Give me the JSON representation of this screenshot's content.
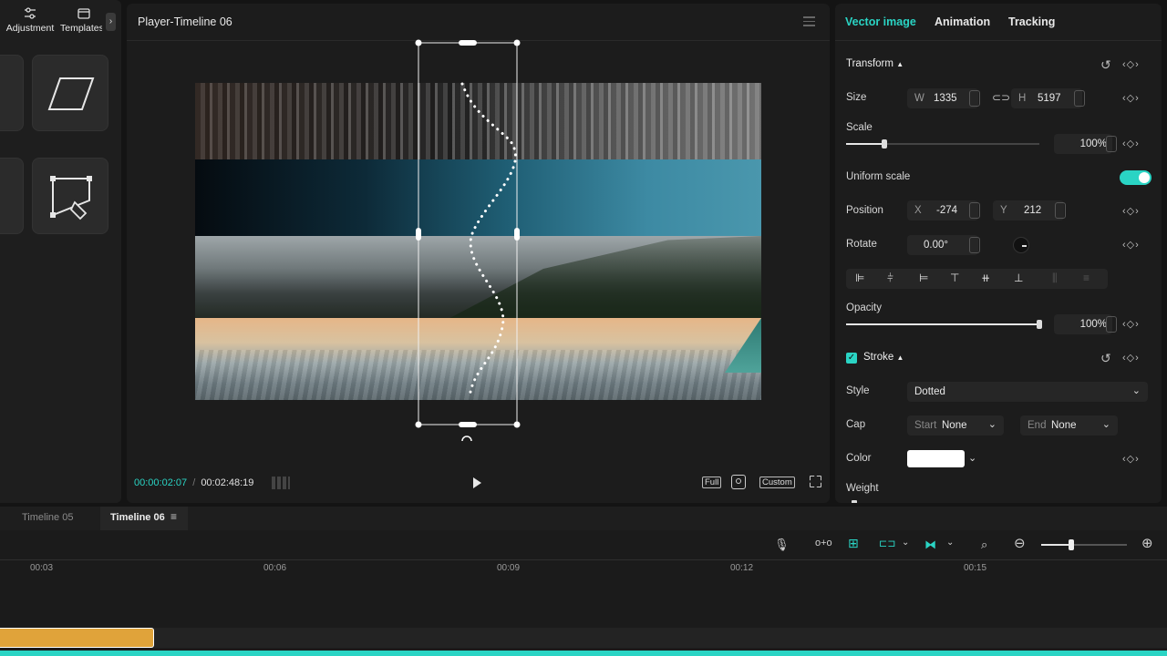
{
  "left_panel": {
    "tabs": [
      {
        "label": "Adjustment",
        "icon": "sliders-icon"
      },
      {
        "label": "Templates",
        "icon": "template-icon"
      }
    ],
    "tiles": [
      {
        "icon": "parallelogram-shape-icon"
      },
      {
        "icon": "pen-path-icon"
      }
    ]
  },
  "player": {
    "title": "Player-Timeline 06",
    "current_time": "00:00:02:07",
    "separator": "/",
    "total_time": "00:02:48:19",
    "full_label": "Full",
    "custom_label": "Custom"
  },
  "inspector": {
    "tabs": [
      "Vector image",
      "Animation",
      "Tracking"
    ],
    "active_tab_color": "#2ad4c4",
    "transform_label": "Transform",
    "size_label": "Size",
    "size_w_label": "W",
    "size_w": "1335",
    "size_h_label": "H",
    "size_h": "5197",
    "scale_label": "Scale",
    "scale_value": "100%",
    "scale_fraction": 0.2,
    "uniform_scale_label": "Uniform scale",
    "uniform_scale_on": true,
    "position_label": "Position",
    "pos_x_label": "X",
    "pos_x": "-274",
    "pos_y_label": "Y",
    "pos_y": "212",
    "rotate_label": "Rotate",
    "rotate_value": "0.00°",
    "opacity_label": "Opacity",
    "opacity_value": "100%",
    "opacity_fraction": 1.0,
    "stroke_label": "Stroke",
    "stroke_enabled": true,
    "style_label": "Style",
    "style_value": "Dotted",
    "cap_label": "Cap",
    "cap_start_label": "Start",
    "cap_start_value": "None",
    "cap_end_label": "End",
    "cap_end_value": "None",
    "color_label": "Color",
    "color_value": "#ffffff",
    "weight_label": "Weight"
  },
  "timeline": {
    "tabs": [
      "Timeline 05",
      "Timeline 06"
    ],
    "ruler": [
      "00:03",
      "00:06",
      "00:09",
      "00:12",
      "00:15"
    ],
    "zoom_fraction": 0.35,
    "clip_color": "#e0a33a",
    "accent_color": "#2ad4c4"
  }
}
